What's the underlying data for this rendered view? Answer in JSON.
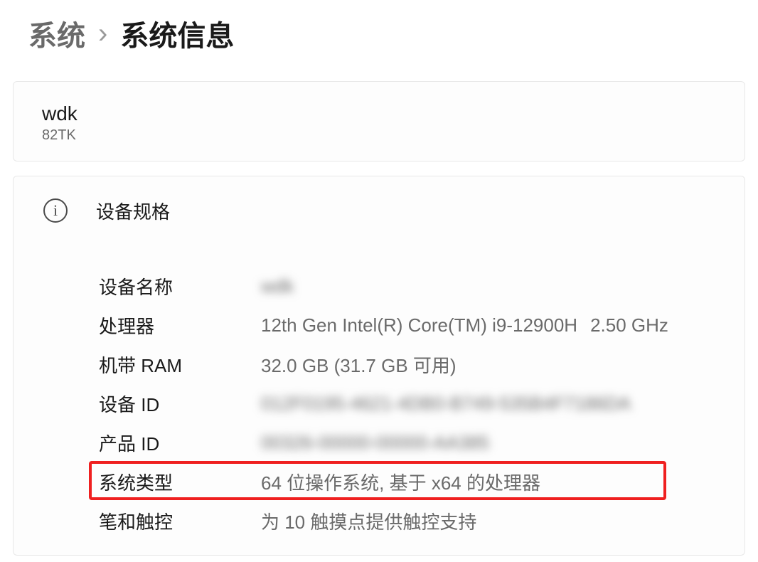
{
  "breadcrumb": {
    "parent": "系统",
    "separator": "›",
    "current": "系统信息"
  },
  "device": {
    "name": "wdk",
    "model": "82TK"
  },
  "specs": {
    "title": "设备规格",
    "rows": [
      {
        "label": "设备名称",
        "value": "wdk",
        "blurred": true
      },
      {
        "label": "处理器",
        "value_a": "12th Gen Intel(R) Core(TM) i9-12900H",
        "value_b": "2.50 GHz"
      },
      {
        "label": "机带 RAM",
        "value": "32.0 GB (31.7 GB 可用)"
      },
      {
        "label": "设备 ID",
        "value": "012F0195-4621-4DB0-B749-535B4F7186DA",
        "blurred": true
      },
      {
        "label": "产品 ID",
        "value": "00326-00000-00000-AA385",
        "blurred": true
      },
      {
        "label": "系统类型",
        "value": "64 位操作系统, 基于 x64 的处理器"
      },
      {
        "label": "笔和触控",
        "value": "为 10 触摸点提供触控支持"
      }
    ]
  }
}
